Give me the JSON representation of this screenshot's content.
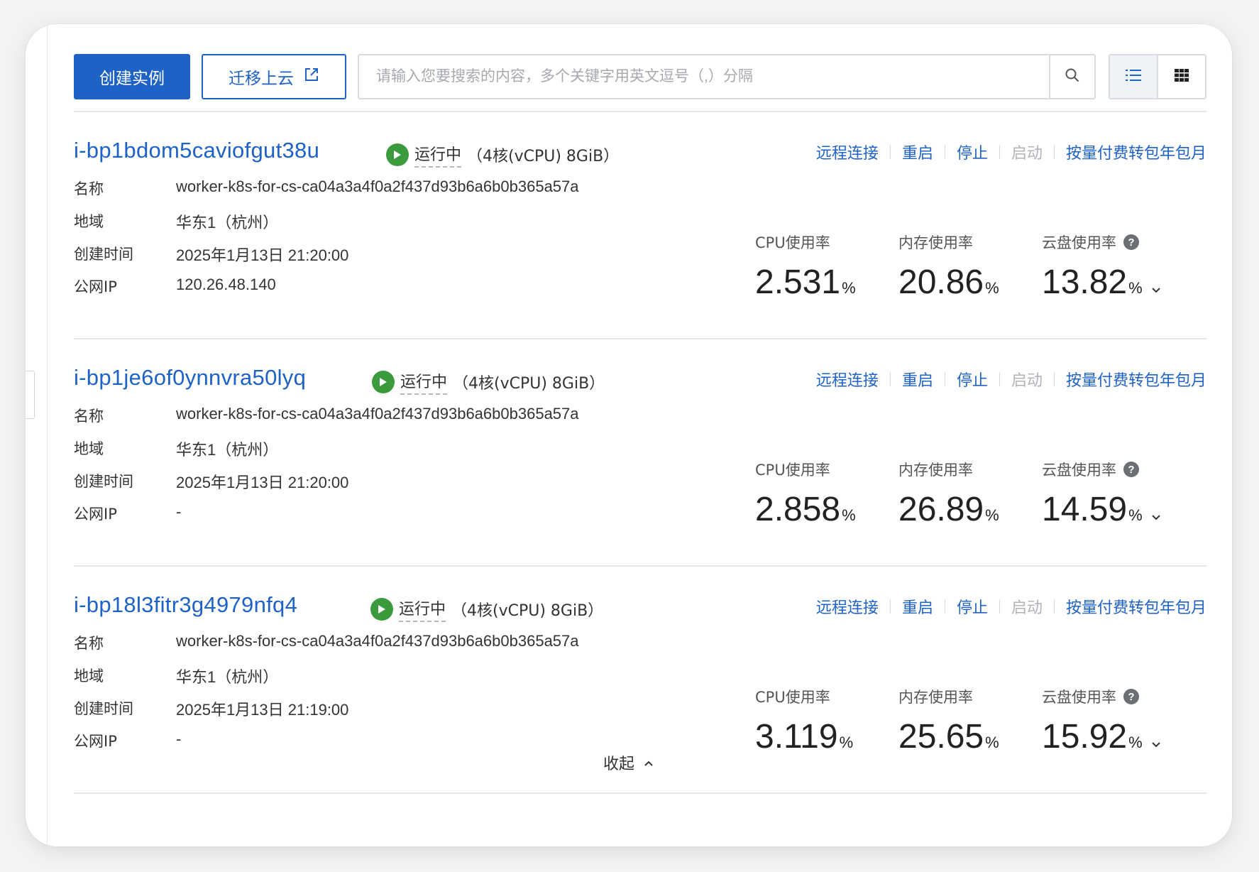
{
  "toolbar": {
    "create_label": "创建实例",
    "migrate_label": "迁移上云",
    "search_placeholder": "请输入您要搜索的内容，多个关键字用英文逗号（,）分隔"
  },
  "actions": {
    "remote": "远程连接",
    "restart": "重启",
    "stop": "停止",
    "start": "启动",
    "convert": "按量付费转包年包月"
  },
  "labels": {
    "name": "名称",
    "region": "地域",
    "created": "创建时间",
    "public_ip": "公网IP",
    "cpu": "CPU使用率",
    "mem": "内存使用率",
    "disk": "云盘使用率",
    "pct": "%"
  },
  "instances": [
    {
      "id": "i-bp1bdom5caviofgut38u",
      "status": "运行中",
      "spec": "（4核(vCPU) 8GiB）",
      "name": "worker-k8s-for-cs-ca04a3a4f0a2f437d93b6a6b0b365a57a",
      "region": "华东1（杭州）",
      "created": "2025年1月13日 21:20:00",
      "public_ip": "120.26.48.140",
      "cpu": "2.531",
      "mem": "20.86",
      "disk": "13.82"
    },
    {
      "id": "i-bp1je6of0ynnvra50lyq",
      "status": "运行中",
      "spec": "（4核(vCPU) 8GiB）",
      "name": "worker-k8s-for-cs-ca04a3a4f0a2f437d93b6a6b0b365a57a",
      "region": "华东1（杭州）",
      "created": "2025年1月13日 21:20:00",
      "public_ip": "-",
      "cpu": "2.858",
      "mem": "26.89",
      "disk": "14.59"
    },
    {
      "id": "i-bp18l3fitr3g4979nfq4",
      "status": "运行中",
      "spec": "（4核(vCPU) 8GiB）",
      "name": "worker-k8s-for-cs-ca04a3a4f0a2f437d93b6a6b0b365a57a",
      "region": "华东1（杭州）",
      "created": "2025年1月13日 21:19:00",
      "public_ip": "-",
      "cpu": "3.119",
      "mem": "25.65",
      "disk": "15.92"
    }
  ],
  "collapse_label": "收起",
  "colors": {
    "primary": "#1f62c6",
    "running": "#3b9a3c",
    "disabled": "#b0b3b8"
  }
}
